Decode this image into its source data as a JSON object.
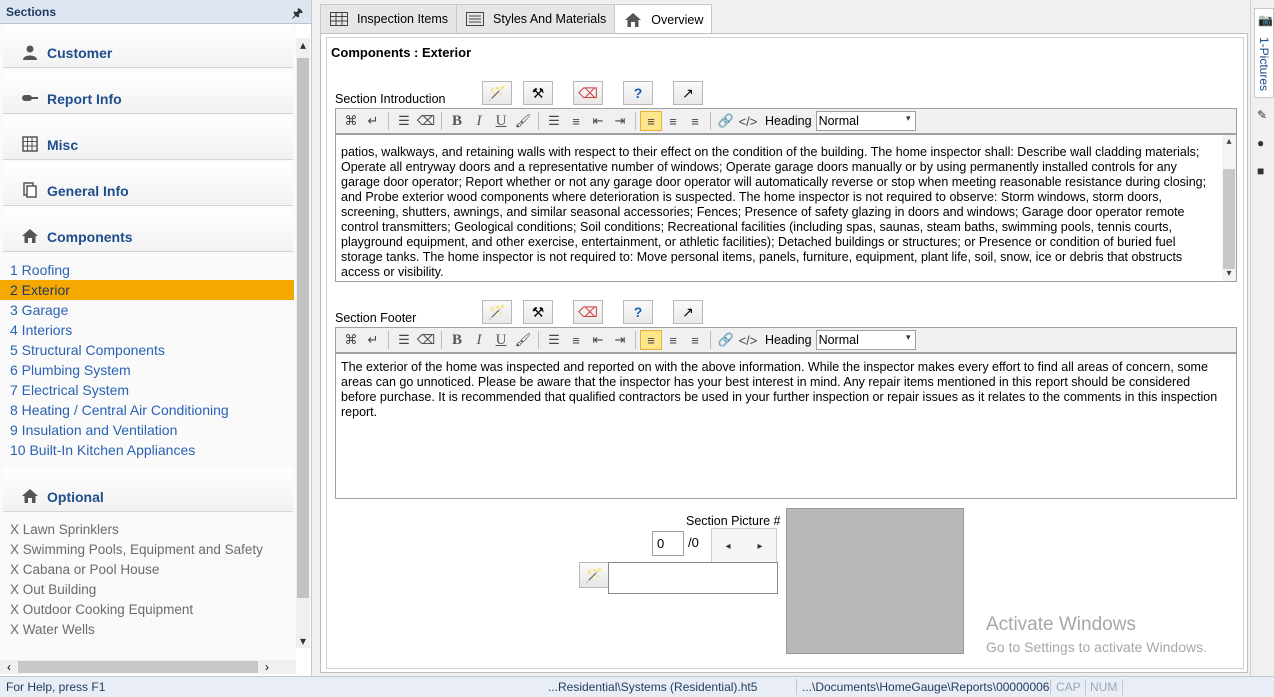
{
  "left_panel": {
    "title": "Sections",
    "headers": {
      "customer": "Customer",
      "report_info": "Report Info",
      "misc": "Misc",
      "general_info": "General Info",
      "components": "Components",
      "optional": "Optional"
    },
    "components": [
      "1 Roofing",
      "2 Exterior",
      "3 Garage",
      "4 Interiors",
      "5 Structural Components",
      "6 Plumbing System",
      "7 Electrical System",
      "8 Heating / Central Air Conditioning",
      "9 Insulation and Ventilation",
      "10 Built-In Kitchen Appliances"
    ],
    "selected_component": "2 Exterior",
    "optional": [
      "X Lawn Sprinklers",
      "X Swimming Pools, Equipment and Safety",
      "X Cabana or Pool House",
      "X Out Building",
      "X Outdoor Cooking Equipment",
      "X Water Wells"
    ]
  },
  "tabs": [
    {
      "label": "Inspection Items",
      "icon": "grid-icon"
    },
    {
      "label": "Styles And Materials",
      "icon": "list-icon"
    },
    {
      "label": "Overview",
      "icon": "home-icon"
    }
  ],
  "active_tab": "Overview",
  "main": {
    "title": "Components : Exterior",
    "intro_label": "Section Introduction",
    "footer_label": "Section Footer",
    "heading_label": "Heading",
    "heading_value": "Normal",
    "intro_text": "patios, walkways, and retaining walls with respect to their effect on the condition of the building. The home inspector shall: Describe wall cladding materials; Operate all entryway doors and a representative number of windows; Operate garage doors manually or by using permanently installed controls for any garage door operator; Report whether or not any garage door operator will automatically reverse or stop when meeting reasonable resistance during closing; and Probe exterior wood components where deterioration is suspected. The home inspector is not required to observe: Storm windows, storm doors, screening, shutters, awnings, and similar seasonal accessories; Fences; Presence of safety glazing in doors and windows; Garage door operator remote control transmitters; Geological conditions; Soil conditions; Recreational facilities (including spas, saunas, steam baths, swimming pools, tennis courts, playground equipment, and other exercise, entertainment, or athletic facilities); Detached buildings or structures; or Presence or condition of buried fuel storage tanks. The home inspector is not required to: Move personal items, panels, furniture, equipment, plant life, soil, snow, ice or debris that obstructs access or visibility.",
    "footer_text": "The exterior of the home was inspected and reported on with the above information. While the inspector makes every effort to find all areas of concern, some areas can go unnoticed. Please be aware that the inspector has your best interest in mind. Any repair items mentioned in this report should be considered before purchase. It is recommended that qualified contractors be used in your further inspection or repair issues as it relates to the comments in this inspection report.",
    "picture_label": "Section Picture #",
    "picture_number": "0",
    "picture_total": "/0"
  },
  "watermark": {
    "line1": "Activate Windows",
    "line2": "Go to Settings to activate Windows."
  },
  "right_panel": {
    "tab_label": "1-Pictures"
  },
  "status": {
    "help": "For Help, press F1",
    "template": "...Residential\\Systems (Residential).ht5",
    "report": "...\\Documents\\HomeGauge\\Reports\\00000006",
    "cap": "CAP",
    "num": "NUM"
  }
}
